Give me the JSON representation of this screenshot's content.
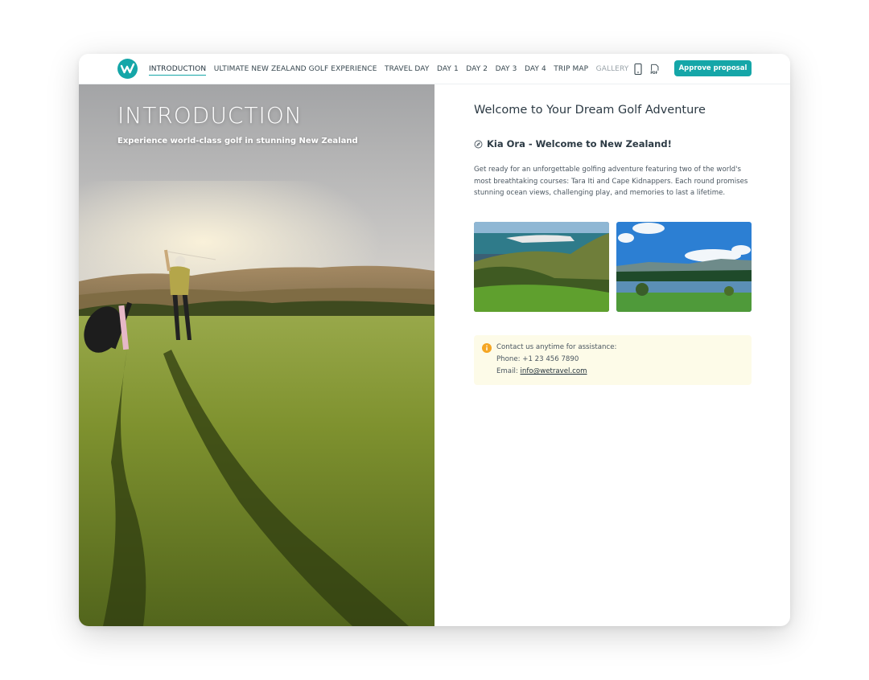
{
  "nav": {
    "items": [
      {
        "label": "INTRODUCTION",
        "active": true
      },
      {
        "label": "ULTIMATE NEW ZEALAND GOLF EXPERIENCE"
      },
      {
        "label": "TRAVEL DAY"
      },
      {
        "label": "DAY 1"
      },
      {
        "label": "DAY 2"
      },
      {
        "label": "DAY 3"
      },
      {
        "label": "DAY 4"
      },
      {
        "label": "TRIP MAP"
      },
      {
        "label": "GALLERY"
      }
    ],
    "icons": [
      "mobile-icon",
      "pdf-icon"
    ],
    "pdf_icon_text": "PDF",
    "approve_label": "Approve proposal"
  },
  "hero": {
    "title": "INTRODUCTION",
    "subtitle": "Experience world-class golf in stunning New Zealand"
  },
  "content": {
    "heading": "Welcome to Your Dream Golf Adventure",
    "subheading": "Kia Ora - Welcome to New Zealand!",
    "paragraph": "Get ready for an unforgettable golfing adventure featuring two of the world's most breathtaking courses: Tara Iti and Cape Kidnappers. Each round promises stunning ocean views, challenging play, and memories to last a lifetime.",
    "contact": {
      "intro": "Contact us anytime for assistance:",
      "phone": "Phone: +1 23 456 7890",
      "email_label": "Email:",
      "email": "info@wetravel.com"
    }
  },
  "colors": {
    "accent": "#15a6a8",
    "contact_bg": "#fdfbe8",
    "info_icon": "#f5a623"
  }
}
